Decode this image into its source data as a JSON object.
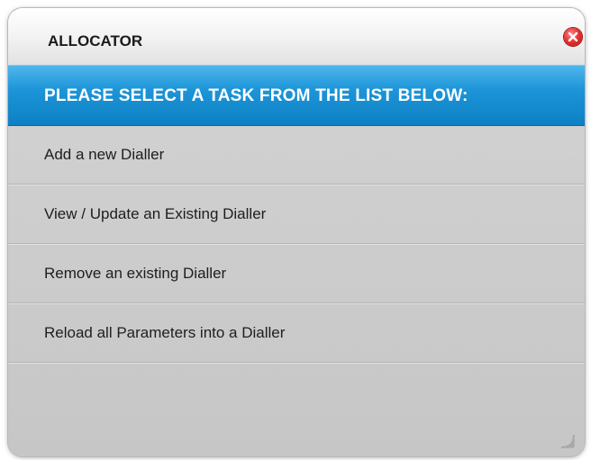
{
  "window": {
    "title": "ALLOCATOR"
  },
  "banner": {
    "text": "PLEASE SELECT A TASK FROM THE LIST BELOW:"
  },
  "tasks": [
    {
      "label": "Add a new Dialler"
    },
    {
      "label": "View / Update an Existing Dialler"
    },
    {
      "label": "Remove an existing Dialler"
    },
    {
      "label": "Reload all Parameters into a Dialler"
    }
  ],
  "icons": {
    "close": "close-icon",
    "resize": "resize-grip-icon"
  },
  "colors": {
    "banner": "#1d95d8",
    "close_button": "#e53030",
    "background": "#c6c6c6"
  }
}
